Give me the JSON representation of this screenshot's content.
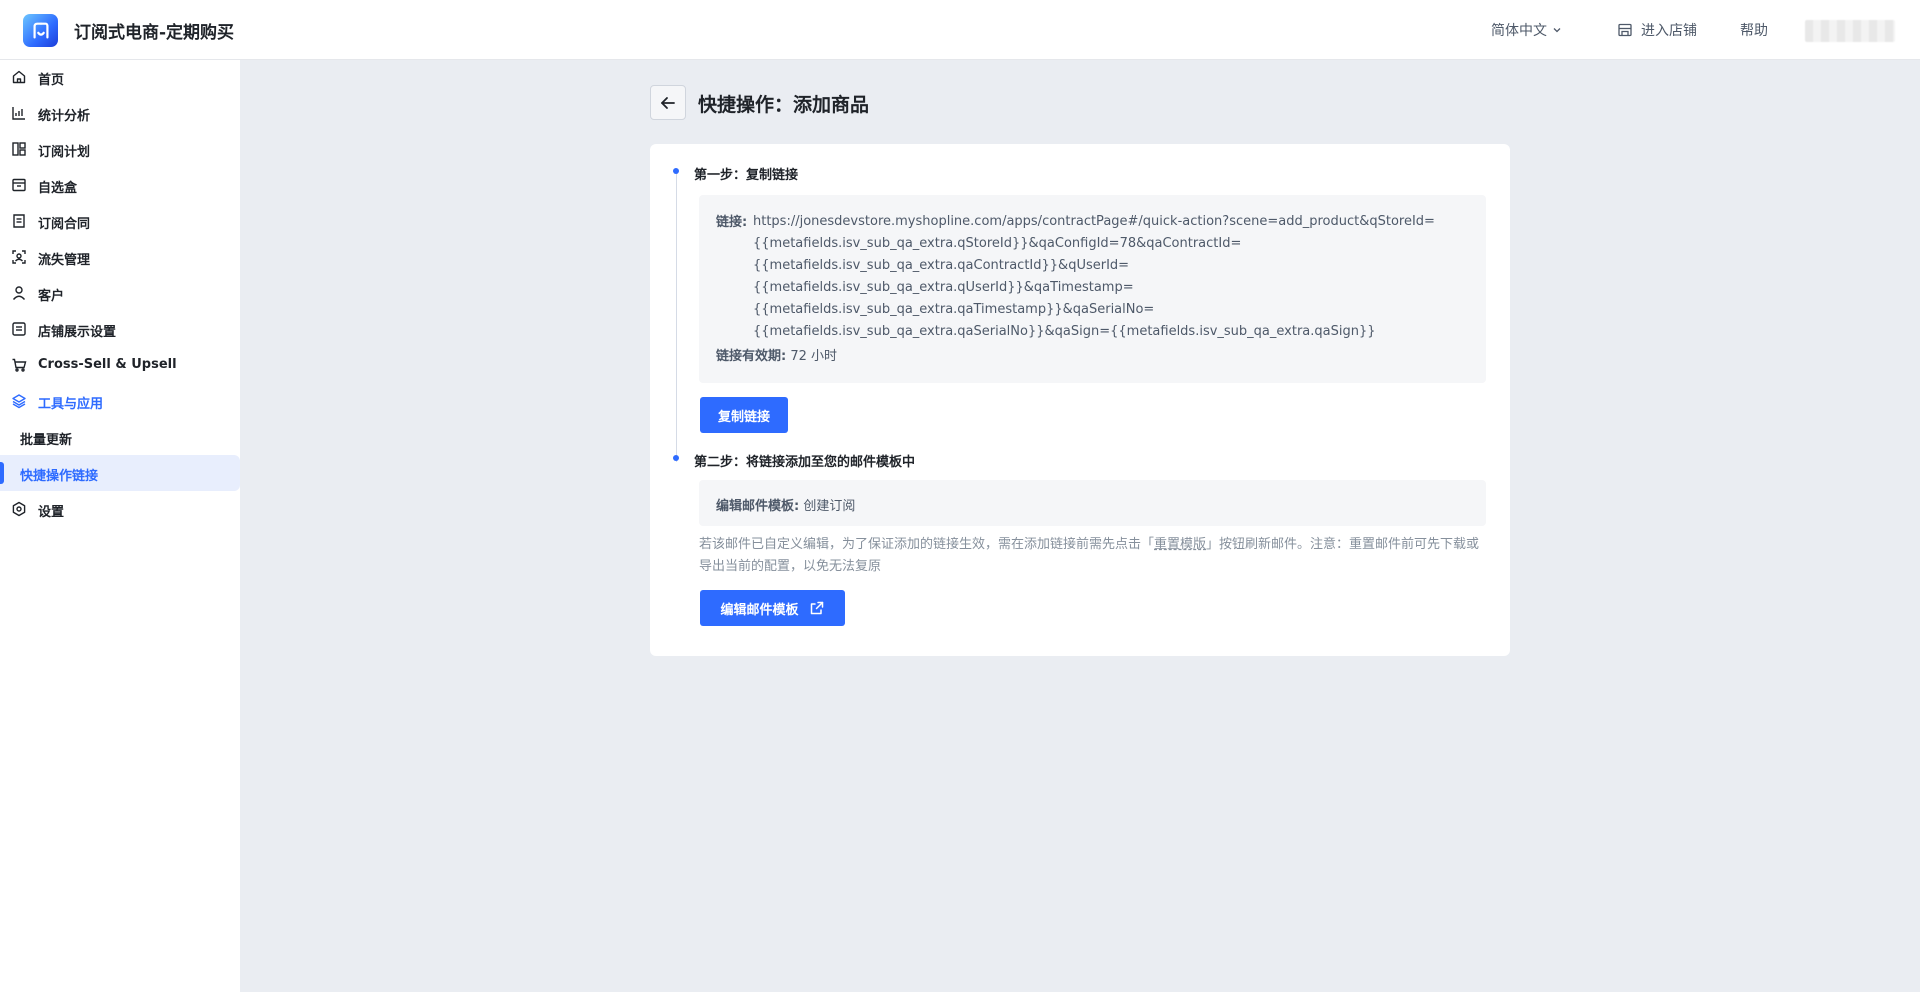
{
  "header": {
    "app_title": "订阅式电商-定期购买",
    "language": "简体中文",
    "enter_store": "进入店铺",
    "help": "帮助"
  },
  "sidebar": {
    "items": [
      {
        "label": "首页",
        "icon": "home-icon"
      },
      {
        "label": "统计分析",
        "icon": "chart-icon"
      },
      {
        "label": "订阅计划",
        "icon": "plan-icon"
      },
      {
        "label": "自选盒",
        "icon": "box-icon"
      },
      {
        "label": "订阅合同",
        "icon": "contract-icon"
      },
      {
        "label": "流失管理",
        "icon": "churn-icon"
      },
      {
        "label": "客户",
        "icon": "user-icon"
      },
      {
        "label": "店铺展示设置",
        "icon": "display-icon"
      },
      {
        "label": "Cross-Sell & Upsell",
        "icon": "cart-icon"
      },
      {
        "label": "工具与应用",
        "icon": "layers-icon"
      },
      {
        "label": "设置",
        "icon": "settings-icon"
      }
    ],
    "sub_items": [
      {
        "label": "批量更新"
      },
      {
        "label": "快捷操作链接"
      }
    ]
  },
  "main": {
    "title": "快捷操作：添加商品",
    "step1": {
      "title": "第一步：复制链接",
      "link_label": "链接:",
      "link_lines": [
        "https://jonesdevstore.myshopline.com/apps/contractPage#/quick-action?scene=add_product&qStoreId=",
        "{{metafields.isv_sub_qa_extra.qStoreId}}&qaConfigId=78&qaContractId=",
        "{{metafields.isv_sub_qa_extra.qaContractId}}&qUserId=",
        "{{metafields.isv_sub_qa_extra.qUserId}}&qaTimestamp=",
        "{{metafields.isv_sub_qa_extra.qaTimestamp}}&qaSerialNo=",
        "{{metafields.isv_sub_qa_extra.qaSerialNo}}&qaSign={{metafields.isv_sub_qa_extra.qaSign}}"
      ],
      "validity_label": "链接有效期:",
      "validity_value": "72 小时",
      "copy_button": "复制链接"
    },
    "step2": {
      "title": "第二步：将链接添加至您的邮件模板中",
      "template_label": "编辑邮件模板:",
      "template_value": "创建订阅",
      "note_before": "若该邮件已自定义编辑，为了保证添加的链接生效，需在添加链接前需先点击「",
      "note_link": "重置模版",
      "note_after": "」按钮刷新邮件。注意：重置邮件前可先下载或导出当前的配置，以免无法复原",
      "edit_button": "编辑邮件模板"
    }
  },
  "colors": {
    "primary": "#2e6bff",
    "background": "#eaedf2",
    "box": "#f5f6f8"
  }
}
